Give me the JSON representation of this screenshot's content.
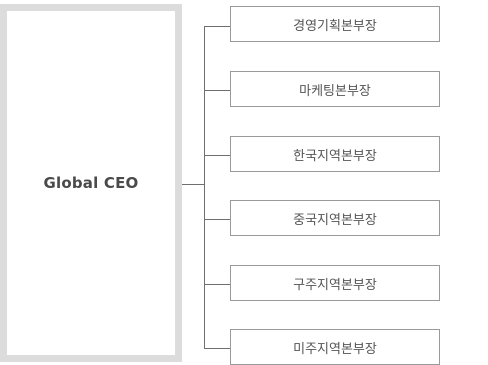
{
  "ceo": {
    "label": "Global CEO"
  },
  "departments": [
    {
      "label": "경영기획본부장"
    },
    {
      "label": "마케팅본부장"
    },
    {
      "label": "한국지역본부장"
    },
    {
      "label": "중국지역본부장"
    },
    {
      "label": "구주지역본부장"
    },
    {
      "label": "미주지역본부장"
    }
  ]
}
